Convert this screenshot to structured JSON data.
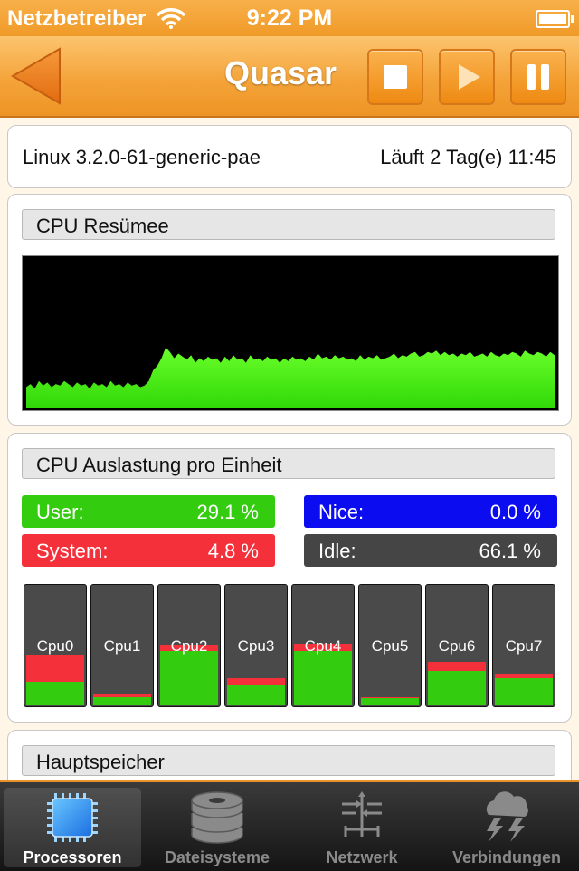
{
  "status_bar": {
    "carrier": "Netzbetreiber",
    "time": "9:22 PM"
  },
  "navbar": {
    "title": "Quasar",
    "back_icon": "back-arrow-icon",
    "buttons": [
      "stop-icon",
      "play-icon",
      "pause-icon"
    ]
  },
  "info": {
    "kernel": "Linux 3.2.0-61-generic-pae",
    "uptime": "Läuft 2 Tag(e) 11:45"
  },
  "cpu_summary": {
    "title": "CPU Resümee",
    "history_pct": [
      14,
      16,
      13,
      18,
      15,
      17,
      14,
      16,
      15,
      18,
      16,
      14,
      17,
      15,
      16,
      13,
      17,
      15,
      16,
      14,
      18,
      15,
      16,
      14,
      17,
      15,
      16,
      14,
      15,
      18,
      25,
      28,
      33,
      40,
      37,
      33,
      36,
      34,
      32,
      35,
      30,
      33,
      31,
      34,
      32,
      33,
      30,
      34,
      31,
      35,
      32,
      33,
      30,
      35,
      32,
      33,
      31,
      34,
      32,
      33,
      30,
      33,
      31,
      34,
      32,
      33,
      31,
      34,
      32,
      36,
      33,
      34,
      32,
      35,
      33,
      34,
      32,
      33,
      31,
      35,
      32,
      34,
      33,
      35,
      32,
      33,
      34,
      36,
      33,
      35,
      34,
      36,
      37,
      34,
      35,
      37,
      36,
      38,
      35,
      37,
      35,
      36,
      34,
      36,
      35,
      37,
      34,
      35,
      36,
      34,
      37,
      35,
      34,
      36,
      35,
      37,
      36,
      34,
      38,
      36,
      35,
      37,
      36,
      34,
      37,
      35
    ]
  },
  "cpu_load": {
    "title": "CPU Auslastung pro Einheit",
    "user": {
      "label": "User:",
      "value": "29.1 %"
    },
    "nice": {
      "label": "Nice:",
      "value": "0.0 %"
    },
    "system": {
      "label": "System:",
      "value": "4.8 %"
    },
    "idle": {
      "label": "Idle:",
      "value": "66.1 %"
    },
    "colors": {
      "user": "#34cc0e",
      "system": "#f4303a",
      "nice": "#0c0cf0",
      "idle": "#454545"
    },
    "cores": [
      {
        "name": "Cpu0",
        "user": 0.2,
        "system": 0.23
      },
      {
        "name": "Cpu1",
        "user": 0.07,
        "system": 0.02
      },
      {
        "name": "Cpu2",
        "user": 0.46,
        "system": 0.05
      },
      {
        "name": "Cpu3",
        "user": 0.17,
        "system": 0.06
      },
      {
        "name": "Cpu4",
        "user": 0.46,
        "system": 0.06
      },
      {
        "name": "Cpu5",
        "user": 0.06,
        "system": 0.01
      },
      {
        "name": "Cpu6",
        "user": 0.29,
        "system": 0.08
      },
      {
        "name": "Cpu7",
        "user": 0.23,
        "system": 0.04
      }
    ]
  },
  "memory": {
    "title": "Hauptspeicher"
  },
  "tabs": [
    {
      "label": "Processoren",
      "icon": "processor-chip-icon",
      "selected": true
    },
    {
      "label": "Dateisysteme",
      "icon": "disk-stack-icon",
      "selected": false
    },
    {
      "label": "Netzwerk",
      "icon": "network-arrows-icon",
      "selected": false
    },
    {
      "label": "Verbindungen",
      "icon": "cloud-lightning-icon",
      "selected": false
    }
  ]
}
